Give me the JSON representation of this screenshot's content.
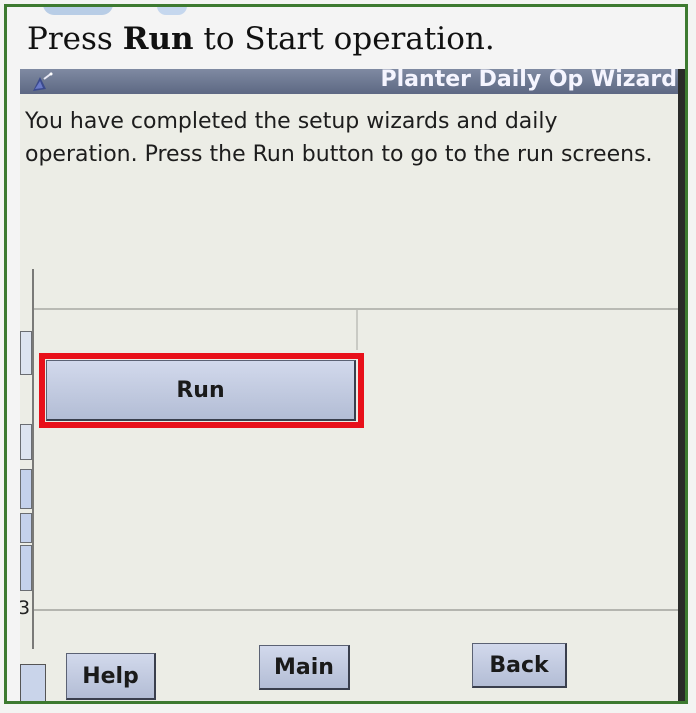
{
  "caption": {
    "before": "Press ",
    "bold": "Run",
    "after": " to Start operation."
  },
  "wizard": {
    "title": "Planter Daily Op Wizard",
    "title_icon": "wizard-hat-icon",
    "message": "You have completed the setup wizards and daily operation. Press the Run button to go to the run screens."
  },
  "buttons": {
    "run": "Run",
    "help": "Help",
    "main": "Main",
    "back": "Back"
  },
  "left_panel": {
    "partial_number": "3"
  },
  "colors": {
    "frame_border": "#3d7a30",
    "highlight": "#e8101a",
    "titlebar": "#6b7591",
    "button": "#c4cce0"
  }
}
